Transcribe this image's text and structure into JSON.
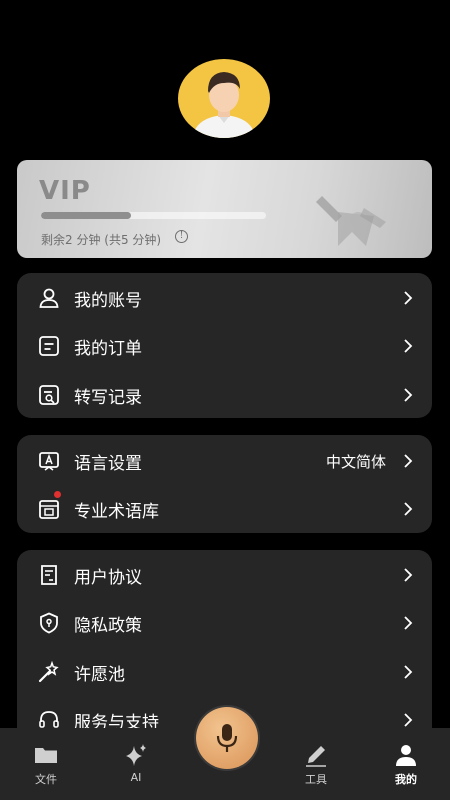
{
  "profile": {
    "avatar_icon": "user-avatar-icon"
  },
  "vip": {
    "title": "VIP",
    "remaining_text": "剩余2 分钟 (共5 分钟)",
    "progress": 0.4,
    "info_glyph": "!"
  },
  "menu_groups": [
    {
      "items": [
        {
          "label": "我的账号",
          "icon": "user-icon"
        },
        {
          "label": "我的订单",
          "icon": "order-icon"
        },
        {
          "label": "转写记录",
          "icon": "transcript-record-icon"
        }
      ]
    },
    {
      "items": [
        {
          "label": "语言设置",
          "value": "中文简体",
          "icon": "language-icon"
        },
        {
          "label": "专业术语库",
          "icon": "glossary-icon",
          "badge": true
        }
      ]
    },
    {
      "items": [
        {
          "label": "用户协议",
          "icon": "agreement-icon"
        },
        {
          "label": "隐私政策",
          "icon": "privacy-shield-icon"
        },
        {
          "label": "许愿池",
          "icon": "magic-wand-icon"
        },
        {
          "label": "服务与支持",
          "icon": "headset-icon"
        }
      ]
    }
  ],
  "tabbar": {
    "tabs": [
      {
        "label": "文件",
        "icon": "folder-icon"
      },
      {
        "label": "AI",
        "icon": "sparkle-icon"
      },
      {
        "label": "工具",
        "icon": "pen-icon"
      },
      {
        "label": "我的",
        "icon": "person-icon",
        "active": true
      }
    ],
    "center_icon": "microphone-icon"
  },
  "colors": {
    "background": "#000000",
    "card": "#262626",
    "accent": "#d99356",
    "badge": "#e03030"
  }
}
